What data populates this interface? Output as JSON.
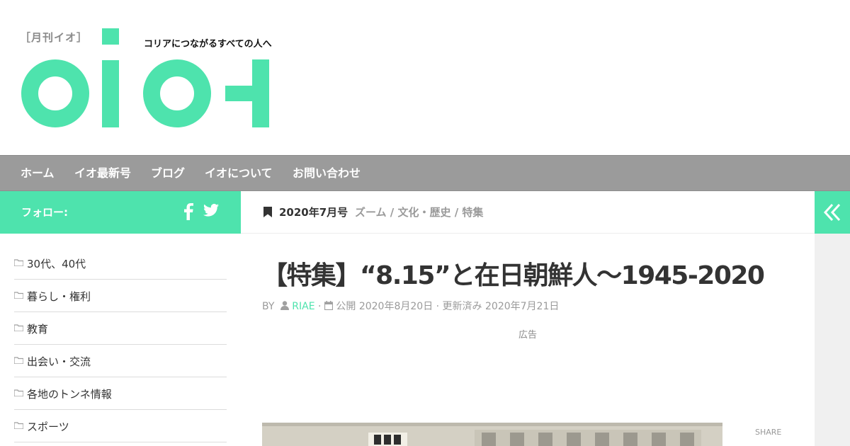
{
  "header": {
    "magazine_label": "［月刊イオ］",
    "tagline": "コリアにつながるすべての人へ",
    "logo_name": "イオ",
    "brand_color": "#4ee3ad"
  },
  "nav": {
    "items": [
      {
        "label": "ホーム"
      },
      {
        "label": "イオ最新号"
      },
      {
        "label": "ブログ"
      },
      {
        "label": "イオについて"
      },
      {
        "label": "お問い合わせ"
      }
    ]
  },
  "sidebar": {
    "follow_label": "フォロー:",
    "social_icons": [
      "facebook-icon",
      "twitter-icon"
    ],
    "categories": [
      {
        "label": "30代、40代"
      },
      {
        "label": "暮らし・権利"
      },
      {
        "label": "教育"
      },
      {
        "label": "出会い・交流"
      },
      {
        "label": "各地のトンネ情報"
      },
      {
        "label": "スポーツ"
      }
    ]
  },
  "post": {
    "issue": "2020年7月号",
    "categories": "ズーム / 文化・歴史 / 特集",
    "title": "【特集】“8.15”と在日朝鮮人～1945-2020",
    "meta": {
      "by": "BY",
      "author": "RIAE",
      "dot": "·",
      "published": "公開 2020年8月20日",
      "updated": "· 更新済み 2020年7月21日"
    },
    "ad_label": "広告",
    "share_label": "SHARE"
  }
}
